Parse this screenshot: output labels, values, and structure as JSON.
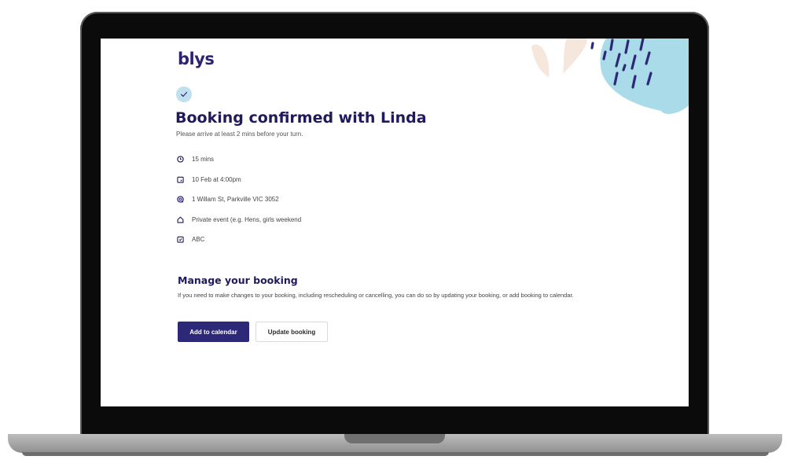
{
  "brand": {
    "name": "blys",
    "color": "#2c2473"
  },
  "confirmation": {
    "title": "Booking confirmed with Linda",
    "subtitle": "Please arrive at least 2 mins before your turn."
  },
  "details": [
    {
      "icon": "clock-icon",
      "text": "15 mins"
    },
    {
      "icon": "calendar-icon",
      "text": "10 Feb at 4:00pm"
    },
    {
      "icon": "location-icon",
      "text": "1 Willam St, Parkville VIC 3052"
    },
    {
      "icon": "home-icon",
      "text": "Private event (e.g. Hens, girls weekend"
    },
    {
      "icon": "note-icon",
      "text": "ABC"
    }
  ],
  "manage": {
    "title": "Manage your booking",
    "description": "If you need to make changes to your booking, including rescheduling or cancelling, you can do so by updating your booking, or add booking to calendar.",
    "add_to_calendar_label": "Add to calendar",
    "update_booking_label": "Update booking"
  },
  "colors": {
    "primary": "#2e2878",
    "heading": "#1e1a5c",
    "check_bg": "#bfe0ec",
    "deco_blue": "#a9dce8",
    "deco_peach": "#f6e7dd"
  }
}
